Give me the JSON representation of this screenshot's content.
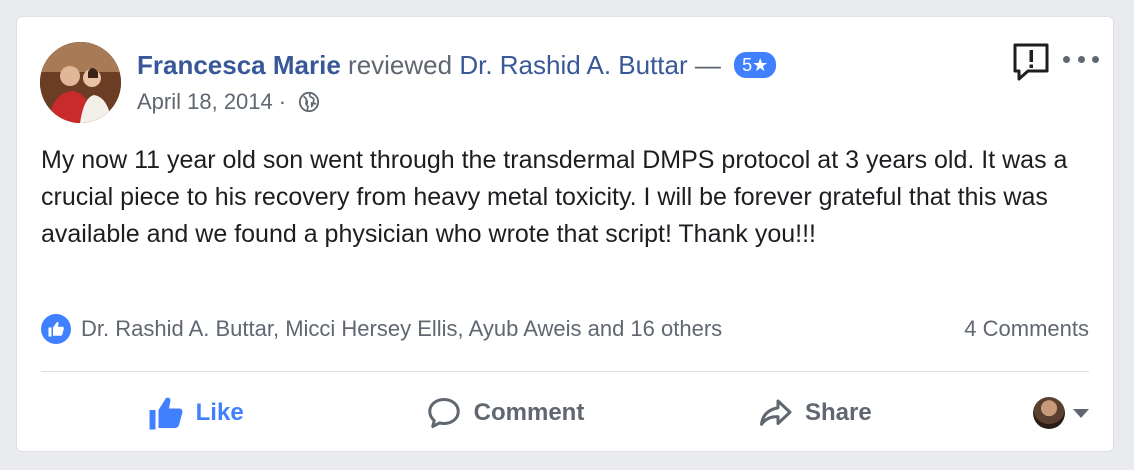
{
  "review": {
    "author": "Francesca Marie",
    "verb": "reviewed",
    "page_name": "Dr. Rashid A. Buttar",
    "dash": "—",
    "rating_label": "5★",
    "rating_value": 5,
    "date": "April 18, 2014",
    "meta_separator": "·",
    "privacy_icon": "globe-icon",
    "text": "My now 11 year old son went through the transdermal DMPS protocol at 3 years old. It was a crucial piece to his recovery from heavy metal toxicity. I will be forever grateful that this was available and we found a physician who wrote that script! Thank you!!!"
  },
  "reactions": {
    "icon": "like-icon",
    "summary": "Dr. Rashid A. Buttar, Micci Hersey Ellis, Ayub Aweis and 16 others",
    "comments_label": "4 Comments"
  },
  "actions": {
    "like_label": "Like",
    "comment_label": "Comment",
    "share_label": "Share"
  },
  "colors": {
    "link_blue": "#385898",
    "accent_blue": "#4080ff",
    "secondary_text": "#606770",
    "background": "#e9ebee"
  }
}
